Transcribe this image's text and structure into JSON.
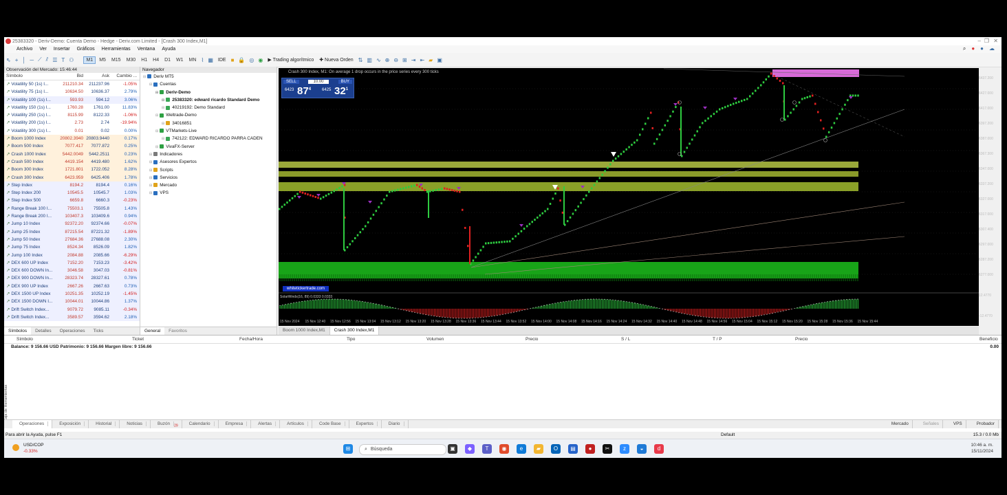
{
  "window": {
    "title": "25383320 - Deriv-Demo: Cuenta Demo - Hedge - Deriv.com Limited - [Crash 300 Index,M1]"
  },
  "menu": [
    "Archivo",
    "Ver",
    "Insertar",
    "Gráficos",
    "Herramientas",
    "Ventana",
    "Ayuda"
  ],
  "toolbar": {
    "timeframes": [
      "M1",
      "M5",
      "M15",
      "M30",
      "H1",
      "H4",
      "D1",
      "W1",
      "MN"
    ],
    "active_timeframe": "M1",
    "ide_label": "IDE",
    "algo_label": "Trading algorítmico",
    "new_order_label": "Nueva Orden"
  },
  "market_watch": {
    "title": "Observación del Mercado: 15:46:44",
    "columns": [
      "Símbolo",
      "Bid",
      "Ask",
      "Cambio ..."
    ],
    "rows": [
      {
        "symbol": "Volatility 50 (1s) I...",
        "bid": "211210.34",
        "ask": "211237.96",
        "change": "-1.05%",
        "bg": "#ffffff"
      },
      {
        "symbol": "Volatility 75 (1s) I...",
        "bid": "10634.50",
        "ask": "10636.37",
        "change": "2.79%",
        "bg": "#ffffff"
      },
      {
        "symbol": "Volatility 100 (1s) I...",
        "bid": "593.93",
        "ask": "594.12",
        "change": "3.06%",
        "bg": "#eef0ff"
      },
      {
        "symbol": "Volatility 150 (1s) I...",
        "bid": "1760.28",
        "ask": "1761.00",
        "change": "11.83%",
        "bg": "#ffffff"
      },
      {
        "symbol": "Volatility 250 (1s) I...",
        "bid": "8115.99",
        "ask": "8122.33",
        "change": "-1.06%",
        "bg": "#ffffff"
      },
      {
        "symbol": "Volatility 200 (1s) I...",
        "bid": "2.73",
        "ask": "2.74",
        "change": "-19.94%",
        "bg": "#ffffff"
      },
      {
        "symbol": "Volatility 300 (1s) I...",
        "bid": "0.01",
        "ask": "0.02",
        "change": "0.00%",
        "bg": "#ffffff"
      },
      {
        "symbol": "Boom 1000 Index",
        "bid": "20802.3940",
        "ask": "20803.9440",
        "change": "0.17%",
        "bg": "#fff1dc"
      },
      {
        "symbol": "Boom 500 Index",
        "bid": "7077.417",
        "ask": "7077.872",
        "change": "0.25%",
        "bg": "#fff1dc"
      },
      {
        "symbol": "Crash 1000 Index",
        "bid": "5442.0049",
        "ask": "5442.2511",
        "change": "0.23%",
        "bg": "#fff1dc"
      },
      {
        "symbol": "Crash 500 Index",
        "bid": "4419.154",
        "ask": "4419.480",
        "change": "1.62%",
        "bg": "#fff1dc"
      },
      {
        "symbol": "Boom 300 Index",
        "bid": "1721.801",
        "ask": "1722.052",
        "change": "8.28%",
        "bg": "#fff1dc"
      },
      {
        "symbol": "Crash 300 Index",
        "bid": "6423.959",
        "ask": "6425.406",
        "change": "1.78%",
        "bg": "#fff1dc"
      },
      {
        "symbol": "Step Index",
        "bid": "8194.2",
        "ask": "8194.4",
        "change": "0.16%",
        "bg": "#eef0ff"
      },
      {
        "symbol": "Step Index 200",
        "bid": "10545.5",
        "ask": "10545.7",
        "change": "1.03%",
        "bg": "#eef0ff"
      },
      {
        "symbol": "Step Index 500",
        "bid": "6659.8",
        "ask": "6660.3",
        "change": "-0.23%",
        "bg": "#eef0ff"
      },
      {
        "symbol": "Range Break 100 I...",
        "bid": "75503.1",
        "ask": "75505.8",
        "change": "1.43%",
        "bg": "#eef0ff"
      },
      {
        "symbol": "Range Break 200 I...",
        "bid": "103407.3",
        "ask": "103409.6",
        "change": "0.94%",
        "bg": "#eef0ff"
      },
      {
        "symbol": "Jump 10 Index",
        "bid": "92372.20",
        "ask": "92374.66",
        "change": "-0.07%",
        "bg": "#eef0ff"
      },
      {
        "symbol": "Jump 25 Index",
        "bid": "87215.54",
        "ask": "87221.32",
        "change": "-1.89%",
        "bg": "#eef0ff"
      },
      {
        "symbol": "Jump 50 Index",
        "bid": "27684.36",
        "ask": "27688.08",
        "change": "2.30%",
        "bg": "#eef0ff"
      },
      {
        "symbol": "Jump 75 Index",
        "bid": "8524.34",
        "ask": "8526.09",
        "change": "1.82%",
        "bg": "#eef0ff"
      },
      {
        "symbol": "Jump 100 Index",
        "bid": "2084.88",
        "ask": "2085.66",
        "change": "-6.29%",
        "bg": "#eef0ff"
      },
      {
        "symbol": "DEX 600 UP Index",
        "bid": "7152.20",
        "ask": "7153.23",
        "change": "-3.42%",
        "bg": "#eef0ff"
      },
      {
        "symbol": "DEX 600 DOWN In...",
        "bid": "3046.58",
        "ask": "3047.03",
        "change": "-0.81%",
        "bg": "#eef0ff"
      },
      {
        "symbol": "DEX 900 DOWN In...",
        "bid": "28323.74",
        "ask": "28327.61",
        "change": "0.78%",
        "bg": "#eef0ff"
      },
      {
        "symbol": "DEX 900 UP Index",
        "bid": "2667.26",
        "ask": "2667.63",
        "change": "0.73%",
        "bg": "#eef0ff"
      },
      {
        "symbol": "DEX 1500 UP Index",
        "bid": "10251.35",
        "ask": "10252.19",
        "change": "-1.45%",
        "bg": "#eef0ff"
      },
      {
        "symbol": "DEX 1500 DOWN I...",
        "bid": "10044.01",
        "ask": "10044.86",
        "change": "1.37%",
        "bg": "#eef0ff"
      },
      {
        "symbol": "Drift Switch Index...",
        "bid": "9079.72",
        "ask": "9085.11",
        "change": "-0.34%",
        "bg": "#eef0ff"
      },
      {
        "symbol": "Drift Switch Index...",
        "bid": "3589.57",
        "ask": "3594.62",
        "change": "2.18%",
        "bg": "#eef0ff"
      }
    ],
    "tabs": [
      "Símbolos",
      "Detalles",
      "Operaciones",
      "Ticks"
    ]
  },
  "navigator": {
    "title": "Navegador",
    "items": [
      {
        "label": "Deriv MT5",
        "indent": 0,
        "bold": false,
        "color": "#2a6fbf"
      },
      {
        "label": "Cuentas",
        "indent": 1,
        "bold": false,
        "color": "#2a6fbf"
      },
      {
        "label": "Deriv-Demo",
        "indent": 2,
        "bold": true,
        "color": "#2ea043"
      },
      {
        "label": "25383320: edward ricardo Standard Demo",
        "indent": 3,
        "bold": true,
        "color": "#3aa655"
      },
      {
        "label": "40219192: Demo Standard",
        "indent": 3,
        "bold": false,
        "color": "#3aa655"
      },
      {
        "label": "Weltrade-Demo",
        "indent": 2,
        "bold": false,
        "color": "#2ea043"
      },
      {
        "label": "34016851",
        "indent": 3,
        "bold": false,
        "color": "#e0a31a"
      },
      {
        "label": "VTMarkets-Live",
        "indent": 2,
        "bold": false,
        "color": "#2ea043"
      },
      {
        "label": "742122: EDWARD RICARDO PARRA CADEN",
        "indent": 3,
        "bold": false,
        "color": "#3aa655"
      },
      {
        "label": "VivaFX-Server",
        "indent": 2,
        "bold": false,
        "color": "#2ea043"
      },
      {
        "label": "Indicadores",
        "indent": 1,
        "bold": false,
        "color": "#7a7a7a"
      },
      {
        "label": "Asesores Expertos",
        "indent": 1,
        "bold": false,
        "color": "#2a6fbf"
      },
      {
        "label": "Scripts",
        "indent": 1,
        "bold": false,
        "color": "#e0a31a"
      },
      {
        "label": "Servicios",
        "indent": 1,
        "bold": false,
        "color": "#2a6fbf"
      },
      {
        "label": "Mercado",
        "indent": 1,
        "bold": false,
        "color": "#e0a31a"
      },
      {
        "label": "VPS",
        "indent": 1,
        "bold": false,
        "color": "#2a6fbf"
      }
    ],
    "tabs": [
      "General",
      "Favoritos"
    ]
  },
  "chart": {
    "title": "Crash 300 Index, M1: On average 1 drop occurs in the price series every 300 ticks",
    "panel": {
      "sell": "SELL",
      "buy": "BUY",
      "volume": "10.00",
      "sell_prefix": "6423",
      "sell_big": "87",
      "sell_sup": "4",
      "buy_prefix": "6425",
      "buy_big": "32",
      "buy_sup": "1"
    },
    "watermark": "whitetickertrade.com",
    "indicator_label": "SolarWinds(16, 89) 0.0333 0.0333",
    "time_labels": [
      "15 Nov 2024",
      "15 Nov 12:40",
      "15 Nov 12:56",
      "15 Nov 13:04",
      "15 Nov 13:12",
      "15 Nov 13:20",
      "15 Nov 13:28",
      "15 Nov 13:36",
      "15 Nov 13:44",
      "15 Nov 13:52",
      "15 Nov 14:00",
      "15 Nov 14:08",
      "15 Nov 14:16",
      "15 Nov 14:24",
      "15 Nov 14:32",
      "15 Nov 14:40",
      "15 Nov 14:48",
      "15 Nov 14:56",
      "15 Nov 15:04",
      "15 Nov 15:12",
      "15 Nov 15:20",
      "15 Nov 15:28",
      "15 Nov 15:36",
      "15 Nov 15:44"
    ],
    "price_labels": [
      "6437.200",
      "6427.000",
      "6417.000",
      "6397.200",
      "6387.000",
      "6367.300",
      "6347.000",
      "6337.200",
      "6327.000",
      "6317.000",
      "6307.400",
      "6297.000",
      "6287.200",
      "6277.000",
      "12.4770",
      "-12.4770"
    ],
    "tabs": [
      "Boom 1000 Index,M1",
      "Crash 300 Index,M1"
    ],
    "active_tab": 1
  },
  "terminal": {
    "columns": [
      "Símbolo",
      "Ticket",
      "Fecha/Hora",
      "Tipo",
      "Volumen",
      "Precio",
      "S / L",
      "T / P",
      "Precio",
      "Beneficio"
    ],
    "balance_text": "Balance: 9 156.66 USD  Patrimonio: 9 156.66  Margen libre: 9 156.66",
    "profit_total": "0.00",
    "side_label": "Caja de Herramientas",
    "tabs": [
      "Operaciones",
      "Exposición",
      "Historial",
      "Noticias",
      "Buzón",
      "Calendario",
      "Empresa",
      "Alertas",
      "Artículos",
      "Code Base",
      "Expertos",
      "Diario"
    ],
    "inbox_badge": "29",
    "right_tabs": [
      "Mercado",
      "Señales",
      "VPS",
      "Probador"
    ]
  },
  "status_bar": {
    "help": "Para abrir la Ayuda, pulse F1",
    "profile": "Default",
    "connection": "15.3 / 0.0 Mb"
  },
  "taskbar": {
    "weather_symbol": "USD/COP",
    "weather_change": "-0.33%",
    "search_placeholder": "Búsqueda",
    "time": "10:46 a. m.",
    "date": "15/11/2024"
  }
}
